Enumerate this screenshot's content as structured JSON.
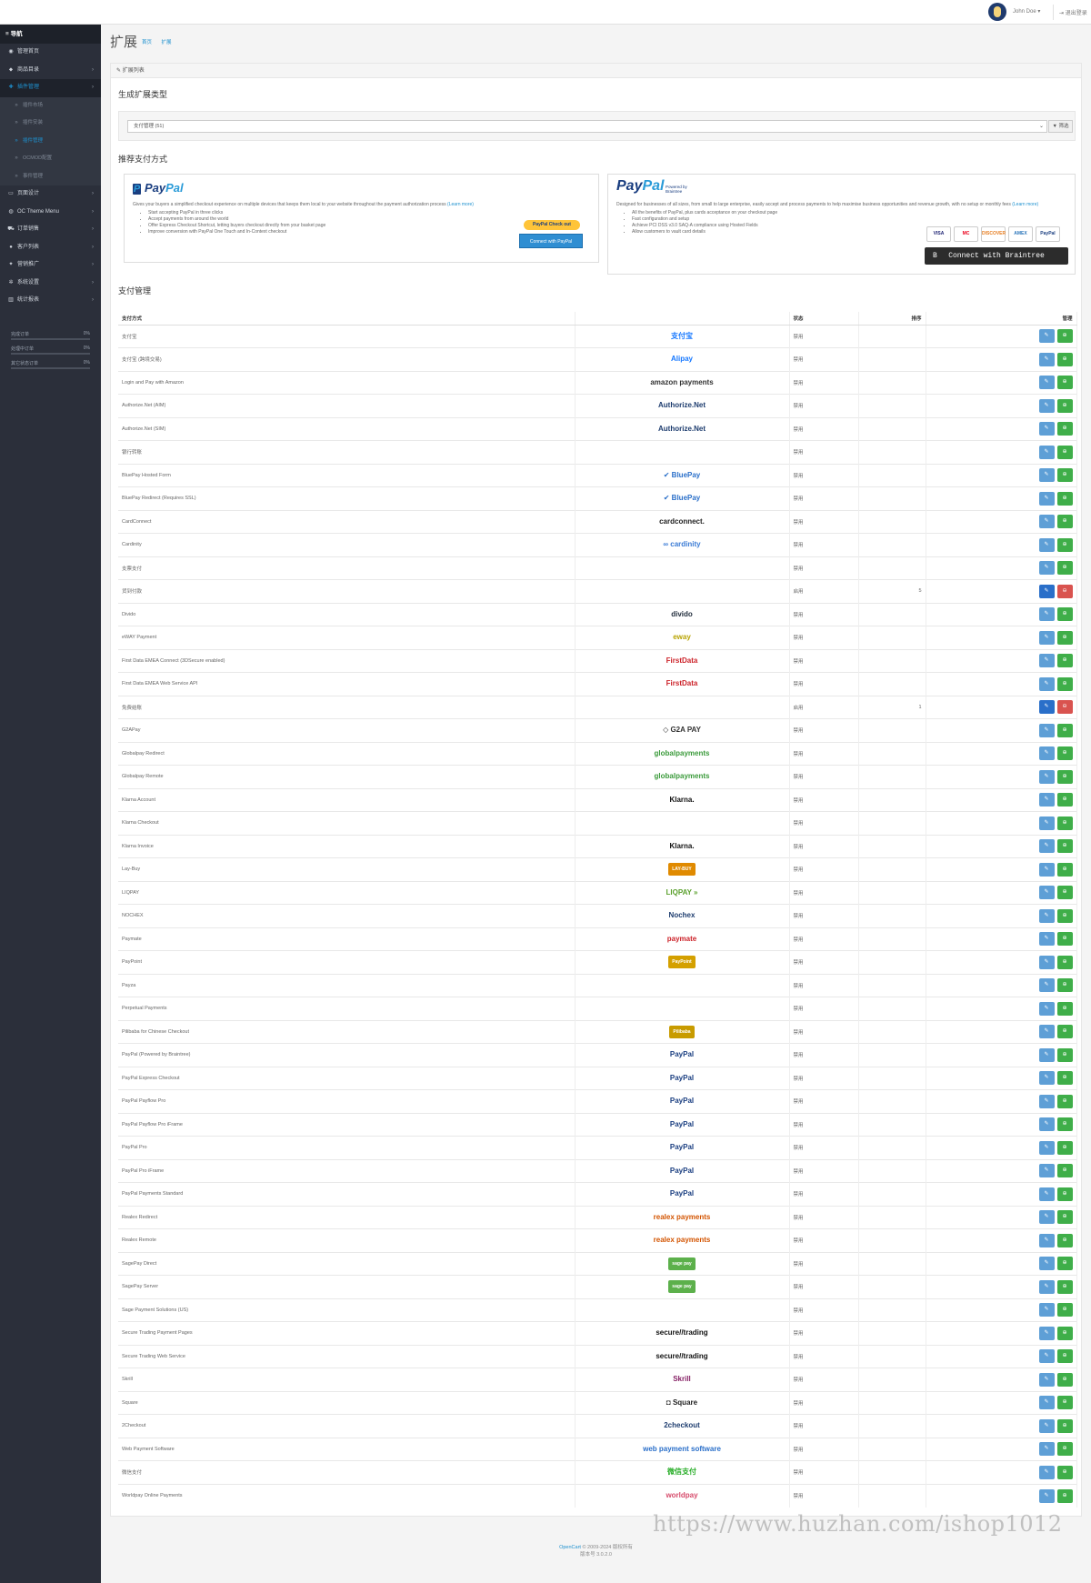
{
  "header": {
    "user": "John Doe ▾",
    "logout": "⇥ 退出登录"
  },
  "sidebar": {
    "nav_title": "≡ 导航",
    "items": [
      {
        "label": "管理首页",
        "icon": "dashboard-icon",
        "glyph": "◉"
      },
      {
        "label": "商品目录",
        "icon": "tag-icon",
        "glyph": "⬥"
      },
      {
        "label": "插件管理",
        "icon": "puzzle-icon",
        "glyph": "✚"
      },
      {
        "label": "插件市场",
        "icon": "dot-icon",
        "glyph": "»"
      },
      {
        "label": "插件安装",
        "icon": "dot-icon",
        "glyph": "»"
      },
      {
        "label": "插件管理",
        "icon": "dot-icon",
        "glyph": "»"
      },
      {
        "label": "OCMOD配置",
        "icon": "dot-icon",
        "glyph": "»"
      },
      {
        "label": "事件管理",
        "icon": "dot-icon",
        "glyph": "»"
      },
      {
        "label": "页面设计",
        "icon": "desktop-icon",
        "glyph": "▭"
      },
      {
        "label": "OC Theme Menu",
        "icon": "theme-icon",
        "glyph": "◍"
      },
      {
        "label": "订单销售",
        "icon": "cart-icon",
        "glyph": "⛟"
      },
      {
        "label": "客户列表",
        "icon": "user-icon",
        "glyph": "●"
      },
      {
        "label": "营销推广",
        "icon": "share-icon",
        "glyph": "✦"
      },
      {
        "label": "系统设置",
        "icon": "gear-icon",
        "glyph": "✲"
      },
      {
        "label": "统计报表",
        "icon": "chart-icon",
        "glyph": "▥"
      }
    ],
    "stats": [
      {
        "label": "完成订单",
        "value": "0%",
        "fraction": 0
      },
      {
        "label": "处理中订单",
        "value": "0%",
        "fraction": 0
      },
      {
        "label": "其它状态订单",
        "value": "0%",
        "fraction": 0
      }
    ]
  },
  "page": {
    "title": "扩展",
    "breadcrumb": [
      "首页",
      "扩展"
    ]
  },
  "panel": {
    "heading": "✎ 扩展列表"
  },
  "filter": {
    "section_title": "生成扩展类型",
    "selected": "支付管理 (51)",
    "button": "▼ 筛选"
  },
  "recommend": {
    "title": "推荐支付方式",
    "paypal": {
      "logo_a": "Pay",
      "logo_b": "Pal",
      "desc": "Gives your buyers a simplified checkout experience on multiple devices that keeps them local to your website throughout the payment authorization process",
      "learn": "(Learn more)",
      "bullets": [
        "Start accepting PayPal in three clicks",
        "Accept payments from around the world",
        "Offer Express Checkout Shortcut, letting buyers checkout directly from your basket page",
        "Improve conversion with PayPal One Touch and In-Context checkout"
      ],
      "checkout_btn": "PayPal  Check out",
      "connect_btn": "Connect with PayPal"
    },
    "braintree": {
      "logo_a": "Pay",
      "logo_b": "Pal",
      "powered": "Powered by Braintree",
      "desc": "Designed for businesses of all sizes, from small to large enterprise, easily accept and process payments to help maximise business opportunities and revenue growth, with no setup or monthly fees",
      "learn": "(Learn more)",
      "bullets": [
        "All the benefits of PayPal, plus cards acceptance on your checkout page",
        "Fast configuration and setup",
        "Achieve PCI DSS v3.0 SAQ-A compliance using Hosted Fields",
        "Allow customers to vault card details"
      ],
      "cards": [
        "VISA",
        "MC",
        "DISCOVER",
        "AMEX",
        "PayPal"
      ],
      "connect_btn": "Connect with Braintree",
      "connect_prefix": "B"
    }
  },
  "payments": {
    "title": "支付管理",
    "columns": [
      "支付方式",
      "",
      "状态",
      "排序",
      "管理"
    ],
    "rows": [
      {
        "name": "支付宝",
        "logo": "支付宝",
        "logo_color": "#1678ff",
        "status": "禁用",
        "sort": "",
        "installed": false
      },
      {
        "name": "支付宝 (跨境交易)",
        "logo": "Alipay",
        "logo_color": "#1678ff",
        "status": "禁用",
        "sort": "",
        "installed": false
      },
      {
        "name": "Login and Pay with Amazon",
        "logo": "amazon payments",
        "logo_color": "#333333",
        "status": "禁用",
        "sort": "",
        "installed": false
      },
      {
        "name": "Authorize.Net (AIM)",
        "logo": "Authorize.Net",
        "logo_color": "#1d3c6e",
        "status": "禁用",
        "sort": "",
        "installed": false
      },
      {
        "name": "Authorize.Net (SIM)",
        "logo": "Authorize.Net",
        "logo_color": "#1d3c6e",
        "status": "禁用",
        "sort": "",
        "installed": false
      },
      {
        "name": "银行转账",
        "logo": "",
        "logo_color": "#333333",
        "status": "禁用",
        "sort": "",
        "installed": false
      },
      {
        "name": "BluePay Hosted Form",
        "logo": "✔ BluePay",
        "logo_color": "#2a6fc9",
        "status": "禁用",
        "sort": "",
        "installed": false
      },
      {
        "name": "BluePay Redirect (Requires SSL)",
        "logo": "✔ BluePay",
        "logo_color": "#2a6fc9",
        "status": "禁用",
        "sort": "",
        "installed": false
      },
      {
        "name": "CardConnect",
        "logo": "cardconnect.",
        "logo_color": "#222222",
        "status": "禁用",
        "sort": "",
        "installed": false
      },
      {
        "name": "Cardinity",
        "logo": "∞ cardinity",
        "logo_color": "#3a7bd5",
        "status": "禁用",
        "sort": "",
        "installed": false
      },
      {
        "name": "支票支付",
        "logo": "",
        "logo_color": "#333333",
        "status": "禁用",
        "sort": "",
        "installed": false
      },
      {
        "name": "货到付款",
        "logo": "",
        "logo_color": "#333333",
        "status": "启用",
        "sort": "5",
        "installed": true
      },
      {
        "name": "Divido",
        "logo": "divido",
        "logo_color": "#1f2b3a",
        "status": "禁用",
        "sort": "",
        "installed": false
      },
      {
        "name": "eWAY Payment",
        "logo": "eway",
        "logo_color": "#b8a300",
        "status": "禁用",
        "sort": "",
        "installed": false
      },
      {
        "name": "First Data EMEA Connect (3DSecure enabled)",
        "logo": "FirstData",
        "logo_color": "#cc2229",
        "status": "禁用",
        "sort": "",
        "installed": false
      },
      {
        "name": "First Data EMEA Web Service API",
        "logo": "FirstData",
        "logo_color": "#cc2229",
        "status": "禁用",
        "sort": "",
        "installed": false
      },
      {
        "name": "免费结账",
        "logo": "",
        "logo_color": "#333333",
        "status": "启用",
        "sort": "1",
        "installed": true
      },
      {
        "name": "G2APay",
        "logo": "◇ G2A PAY",
        "logo_color": "#333333",
        "status": "禁用",
        "sort": "",
        "installed": false
      },
      {
        "name": "Globalpay Redirect",
        "logo": "globalpayments",
        "logo_color": "#3a9a3a",
        "status": "禁用",
        "sort": "",
        "installed": false
      },
      {
        "name": "Globalpay Remote",
        "logo": "globalpayments",
        "logo_color": "#3a9a3a",
        "status": "禁用",
        "sort": "",
        "installed": false
      },
      {
        "name": "Klarna Account",
        "logo": "Klarna.",
        "logo_color": "#111111",
        "status": "禁用",
        "sort": "",
        "installed": false
      },
      {
        "name": "Klarna Checkout",
        "logo": "",
        "logo_color": "#111111",
        "status": "禁用",
        "sort": "",
        "installed": false
      },
      {
        "name": "Klarna Invoice",
        "logo": "Klarna.",
        "logo_color": "#111111",
        "status": "禁用",
        "sort": "",
        "installed": false
      },
      {
        "name": "Lay-Buy",
        "logo": "LAY-BUY",
        "logo_color": "#e08a00",
        "status": "禁用",
        "sort": "",
        "installed": false
      },
      {
        "name": "LIQPAY",
        "logo": "LIQPAY »",
        "logo_color": "#5aa02c",
        "status": "禁用",
        "sort": "",
        "installed": false
      },
      {
        "name": "NOCHEX",
        "logo": "Nochex",
        "logo_color": "#1d3c6e",
        "status": "禁用",
        "sort": "",
        "installed": false
      },
      {
        "name": "Paymate",
        "logo": "paymate",
        "logo_color": "#cc2229",
        "status": "禁用",
        "sort": "",
        "installed": false
      },
      {
        "name": "PayPoint",
        "logo": "PayPoint",
        "logo_color": "#d4a000",
        "status": "禁用",
        "sort": "",
        "installed": false
      },
      {
        "name": "Payza",
        "logo": "",
        "logo_color": "#333333",
        "status": "禁用",
        "sort": "",
        "installed": false
      },
      {
        "name": "Perpetual Payments",
        "logo": "",
        "logo_color": "#333333",
        "status": "禁用",
        "sort": "",
        "installed": false
      },
      {
        "name": "Pilibaba for Chinese Checkout",
        "logo": "Pilibaba",
        "logo_color": "#c89b00",
        "status": "禁用",
        "sort": "",
        "installed": false
      },
      {
        "name": "PayPal (Powered by Braintree)",
        "logo": "PayPal",
        "logo_color": "#1a3e80",
        "status": "禁用",
        "sort": "",
        "installed": false
      },
      {
        "name": "PayPal Express Checkout",
        "logo": "PayPal",
        "logo_color": "#1a3e80",
        "status": "禁用",
        "sort": "",
        "installed": false
      },
      {
        "name": "PayPal Payflow Pro",
        "logo": "PayPal",
        "logo_color": "#1a3e80",
        "status": "禁用",
        "sort": "",
        "installed": false
      },
      {
        "name": "PayPal Payflow Pro iFrame",
        "logo": "PayPal",
        "logo_color": "#1a3e80",
        "status": "禁用",
        "sort": "",
        "installed": false
      },
      {
        "name": "PayPal Pro",
        "logo": "PayPal",
        "logo_color": "#1a3e80",
        "status": "禁用",
        "sort": "",
        "installed": false
      },
      {
        "name": "PayPal Pro iFrame",
        "logo": "PayPal",
        "logo_color": "#1a3e80",
        "status": "禁用",
        "sort": "",
        "installed": false
      },
      {
        "name": "PayPal Payments Standard",
        "logo": "PayPal",
        "logo_color": "#1a3e80",
        "status": "禁用",
        "sort": "",
        "installed": false
      },
      {
        "name": "Realex Redirect",
        "logo": "realex payments",
        "logo_color": "#d35400",
        "status": "禁用",
        "sort": "",
        "installed": false
      },
      {
        "name": "Realex Remote",
        "logo": "realex payments",
        "logo_color": "#d35400",
        "status": "禁用",
        "sort": "",
        "installed": false
      },
      {
        "name": "SagePay Direct",
        "logo": "sage pay",
        "logo_color": "#5cb04b",
        "status": "禁用",
        "sort": "",
        "installed": false
      },
      {
        "name": "SagePay Server",
        "logo": "sage pay",
        "logo_color": "#5cb04b",
        "status": "禁用",
        "sort": "",
        "installed": false
      },
      {
        "name": "Sage Payment Solutions (US)",
        "logo": "",
        "logo_color": "#333333",
        "status": "禁用",
        "sort": "",
        "installed": false
      },
      {
        "name": "Secure Trading Payment Pages",
        "logo": "secure//trading",
        "logo_color": "#111111",
        "status": "禁用",
        "sort": "",
        "installed": false
      },
      {
        "name": "Secure Trading Web Service",
        "logo": "secure//trading",
        "logo_color": "#111111",
        "status": "禁用",
        "sort": "",
        "installed": false
      },
      {
        "name": "Skrill",
        "logo": "Skrill",
        "logo_color": "#862165",
        "status": "禁用",
        "sort": "",
        "installed": false
      },
      {
        "name": "Square",
        "logo": "◘ Square",
        "logo_color": "#222222",
        "status": "禁用",
        "sort": "",
        "installed": false
      },
      {
        "name": "2Checkout",
        "logo": "2checkout",
        "logo_color": "#1d3c6e",
        "status": "禁用",
        "sort": "",
        "installed": false
      },
      {
        "name": "Web Payment Software",
        "logo": "web payment software",
        "logo_color": "#2a6fc9",
        "status": "禁用",
        "sort": "",
        "installed": false
      },
      {
        "name": "微信支付",
        "logo": "微信支付",
        "logo_color": "#2aae2a",
        "status": "禁用",
        "sort": "",
        "installed": false
      },
      {
        "name": "Worldpay Online Payments",
        "logo": "worldpay",
        "logo_color": "#d64a6a",
        "status": "禁用",
        "sort": "",
        "installed": false
      }
    ]
  },
  "footer": {
    "brand": "OpenCart",
    "copyright": " © 2009-2024 版权所有",
    "version": "版本号 3.0.2.0"
  },
  "watermark": "https://www.huzhan.com/ishop1012"
}
